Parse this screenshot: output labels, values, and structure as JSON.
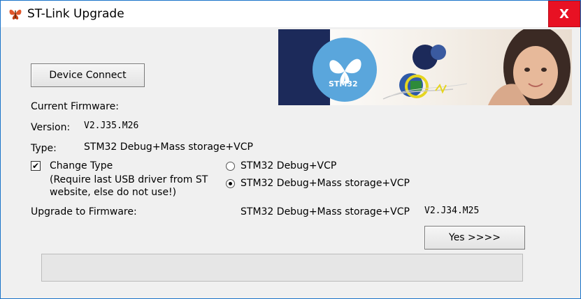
{
  "window": {
    "title": "ST-Link Upgrade",
    "close_glyph": "X"
  },
  "buttons": {
    "device_connect": "Device Connect",
    "yes": "Yes >>>>"
  },
  "firmware": {
    "current_label": "Current Firmware:",
    "version_label": "Version:",
    "version_value": "V2.J35.M26",
    "type_label": "Type:",
    "type_value": "STM32 Debug+Mass storage+VCP"
  },
  "change_type": {
    "checkbox_label": "Change Type",
    "checked": true,
    "note_line1": "(Require last USB driver from ST",
    "note_line2": "website, else do not use!)"
  },
  "radio_options": [
    {
      "label": "STM32 Debug+VCP",
      "selected": false
    },
    {
      "label": "STM32 Debug+Mass storage+VCP",
      "selected": true
    }
  ],
  "upgrade": {
    "label": "Upgrade to Firmware:",
    "type_value": "STM32 Debug+Mass storage+VCP",
    "version_value": "V2.J34.M25"
  },
  "banner": {
    "logo_text": "STM32"
  },
  "progress": {
    "fraction": 0
  },
  "colors": {
    "close_bg": "#e81123",
    "window_bg": "#f0f0f0",
    "banner_navy": "#1c2a5a",
    "logo_blue": "#5aa6dc"
  }
}
